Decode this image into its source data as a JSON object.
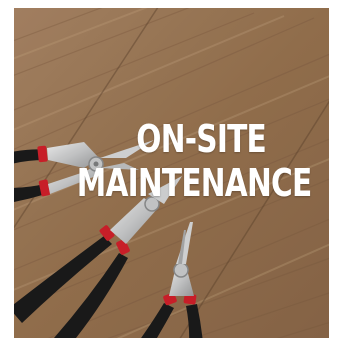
{
  "image": {
    "headline_line1": "ON-SITE",
    "headline_line2": "MAINTENANCE",
    "subject": "pliers on wooden table",
    "colors": {
      "wood_base": "#9a7657",
      "wood_light": "#b89572",
      "wood_dark": "#6e5038",
      "handle_black": "#1b1b1b",
      "handle_red": "#d0202a",
      "metal": "#d9dadb",
      "text": "#ffffff"
    }
  }
}
